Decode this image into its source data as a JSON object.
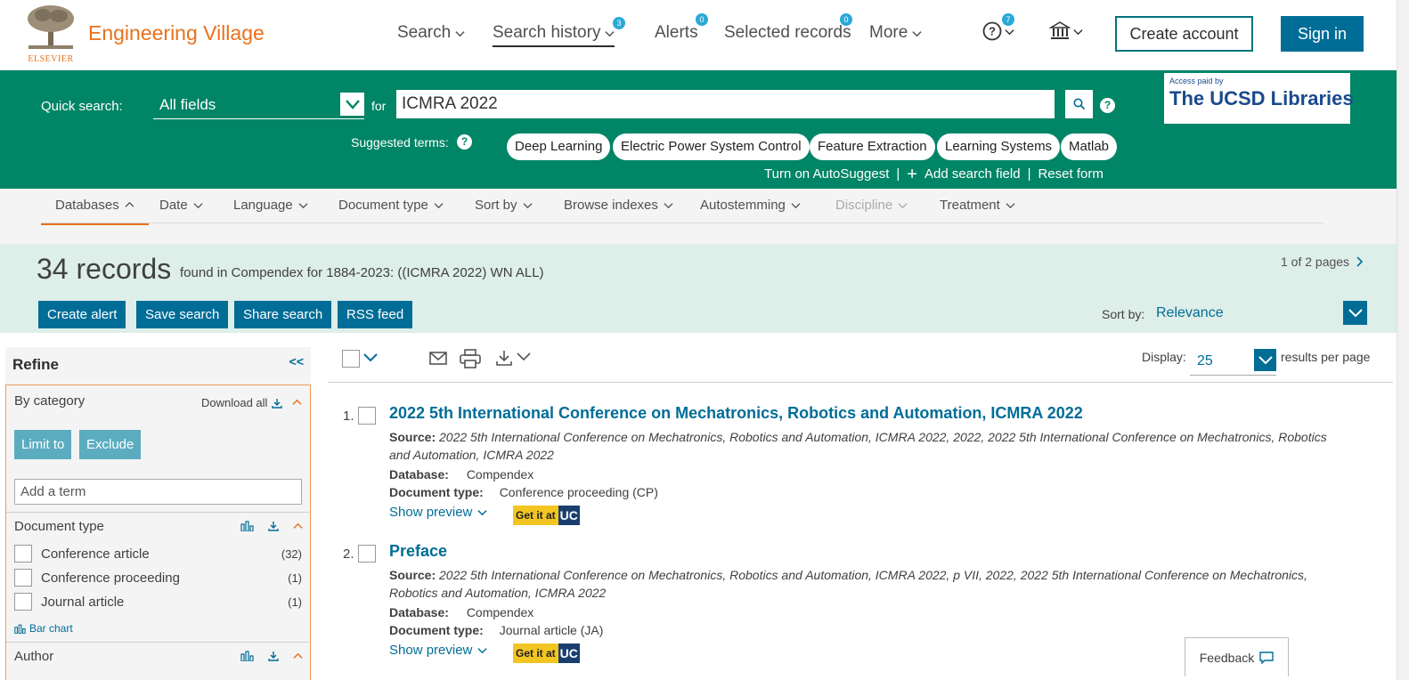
{
  "header": {
    "brand": "Engineering Village",
    "publisher": "ELSEVIER",
    "nav": {
      "search": "Search",
      "search_history": "Search history",
      "search_history_badge": "3",
      "alerts": "Alerts",
      "alerts_badge": "0",
      "selected_records": "Selected records",
      "selected_records_badge": "0",
      "more": "More"
    },
    "help_badge": "7",
    "create_account": "Create account",
    "sign_in": "Sign in"
  },
  "quick_search": {
    "label": "Quick search:",
    "field": "All fields",
    "for_label": "for",
    "query": "ICMRA 2022",
    "suggested_label": "Suggested terms:",
    "suggested_terms": [
      "Deep Learning",
      "Electric Power System Control",
      "Feature Extraction",
      "Learning Systems",
      "Matlab"
    ],
    "autosuggest": "Turn on AutoSuggest",
    "add_field": "Add search field",
    "reset": "Reset form",
    "access_small": "Access paid by",
    "access_big": "The UCSD Libraries"
  },
  "filters": [
    "Databases",
    "Date",
    "Language",
    "Document type",
    "Sort by",
    "Browse indexes",
    "Autostemming",
    "Discipline",
    "Treatment"
  ],
  "results_header": {
    "count": "34 records",
    "description": "found in Compendex for 1884-2023: ((ICMRA 2022) WN ALL)",
    "pages": "1 of 2 pages",
    "actions": [
      "Create alert",
      "Save search",
      "Share search",
      "RSS feed"
    ],
    "sort_label": "Sort by:",
    "sort_value": "Relevance"
  },
  "refine": {
    "title": "Refine",
    "collapse": "<<",
    "by_category": "By category",
    "download_all": "Download all",
    "limit_to": "Limit to",
    "exclude": "Exclude",
    "term_placeholder": "Add a term",
    "doc_type_title": "Document type",
    "doc_types": [
      {
        "label": "Conference article",
        "count": "(32)"
      },
      {
        "label": "Conference proceeding",
        "count": "(1)"
      },
      {
        "label": "Journal article",
        "count": "(1)"
      }
    ],
    "bar_chart": "Bar chart",
    "author_title": "Author"
  },
  "toolbar": {
    "display_label": "Display:",
    "display_value": "25",
    "per_page": "results per page"
  },
  "results": [
    {
      "num": "1.",
      "title": "2022 5th International Conference on Mechatronics, Robotics and Automation, ICMRA 2022",
      "source_label": "Source:",
      "source": "2022 5th International Conference on Mechatronics, Robotics and Automation, ICMRA 2022, 2022, 2022 5th International Conference on Mechatronics, Robotics and Automation, ICMRA 2022",
      "database_label": "Database:",
      "database": "Compendex",
      "doctype_label": "Document type:",
      "doctype": "Conference proceeding (CP)",
      "preview": "Show preview",
      "getit": "Get it at",
      "getit_uc": "UC"
    },
    {
      "num": "2.",
      "title": "Preface",
      "source_label": "Source:",
      "source": "2022 5th International Conference on Mechatronics, Robotics and Automation, ICMRA 2022, p VII, 2022, 2022 5th International Conference on Mechatronics, Robotics and Automation, ICMRA 2022",
      "database_label": "Database:",
      "database": "Compendex",
      "doctype_label": "Document type:",
      "doctype": "Journal article (JA)",
      "preview": "Show preview",
      "getit": "Get it at",
      "getit_uc": "UC"
    }
  ],
  "feedback": "Feedback",
  "colors": {
    "brand_orange": "#e9711c",
    "green_band": "#008566",
    "link_blue": "#006d97",
    "badge_blue": "#29a9d6",
    "light_band": "#deeee9"
  }
}
